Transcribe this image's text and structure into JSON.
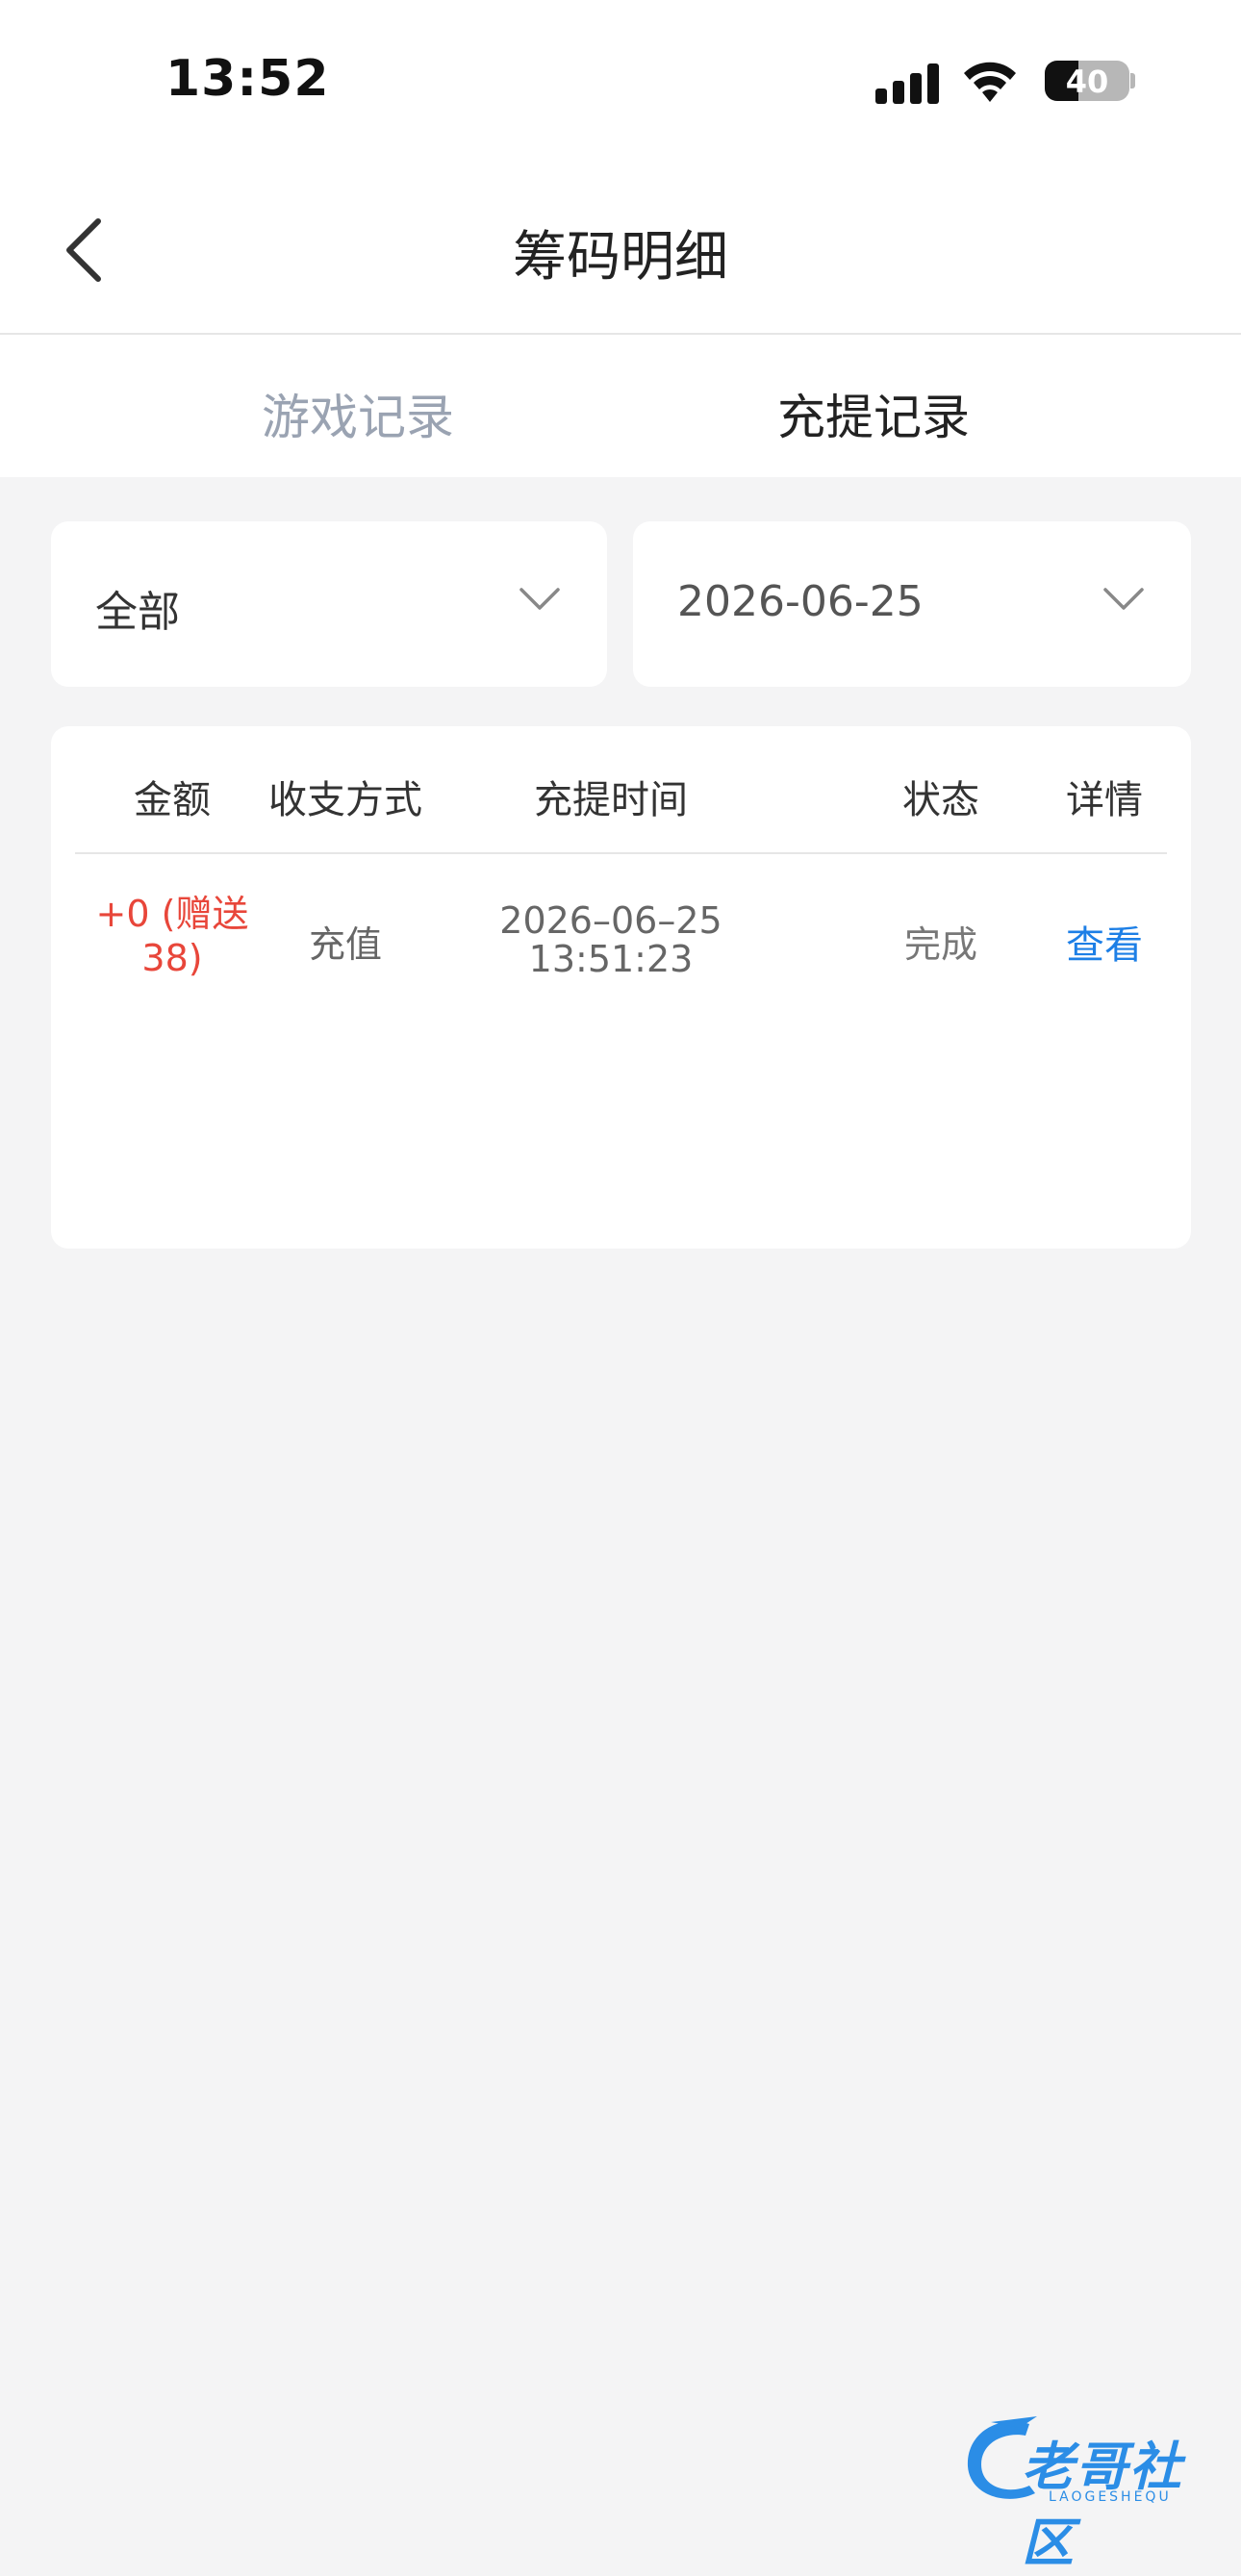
{
  "status_bar": {
    "time": "13:52",
    "battery": "40",
    "battery_level": 0.4,
    "icons": [
      "signal-icon",
      "wifi-icon",
      "battery-icon"
    ]
  },
  "nav": {
    "title": "筹码明细",
    "back_icon": "chevron-left-icon"
  },
  "tabs": [
    {
      "label": "游戏记录",
      "active": false
    },
    {
      "label": "充提记录",
      "active": true
    }
  ],
  "filters": {
    "type": {
      "value": "全部",
      "icon": "chevron-down-icon"
    },
    "date": {
      "value": "2026-06-25",
      "icon": "chevron-down-icon"
    }
  },
  "table": {
    "headers": [
      "金额",
      "收支方式",
      "充提时间",
      "状态",
      "详情"
    ],
    "rows": [
      {
        "amount_line1": "+0 (赠送",
        "amount_line2": "38)",
        "method": "充值",
        "date": "2026–06–25",
        "time": "13:51:23",
        "status": "完成",
        "detail": "查看"
      }
    ]
  },
  "watermark": {
    "text": "老哥社区",
    "sub": "LAOGESHEQU"
  },
  "colors": {
    "background": "#f4f4f5",
    "amount_red": "#e8463a",
    "link_blue": "#1d7fe6",
    "inactive_tab": "#9aa3b2"
  }
}
